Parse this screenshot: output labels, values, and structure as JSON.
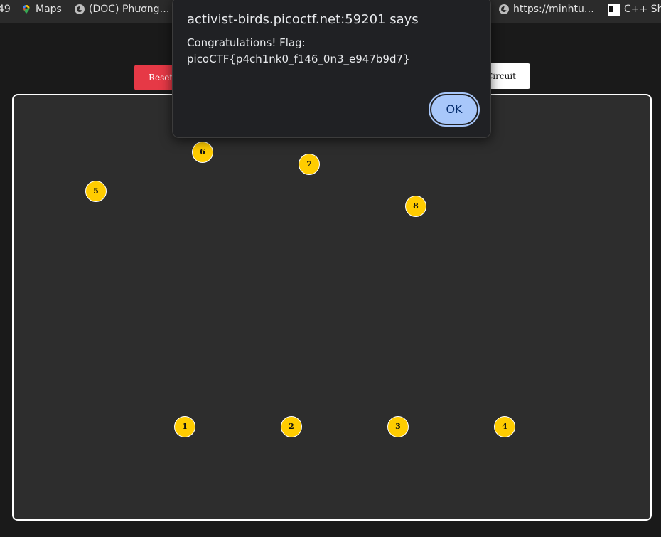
{
  "bookmarks": {
    "items": [
      {
        "label": "49",
        "icon": "none"
      },
      {
        "label": "Maps",
        "icon": "maps-pin-icon"
      },
      {
        "label": "(DOC) Phương…",
        "icon": "globe-icon"
      },
      {
        "label": "https://minhtu…",
        "icon": "globe-icon"
      },
      {
        "label": "C++ She",
        "icon": "sheet-icon"
      }
    ]
  },
  "toolbar": {
    "reset_label": "Reset",
    "circuit_label": "Circuit"
  },
  "board": {
    "nodes": [
      {
        "label": "1"
      },
      {
        "label": "2"
      },
      {
        "label": "3"
      },
      {
        "label": "4"
      },
      {
        "label": "5"
      },
      {
        "label": "6"
      },
      {
        "label": "7"
      },
      {
        "label": "8"
      }
    ],
    "node_color": "#ffcc00"
  },
  "dialog": {
    "title": "activist-birds.picoctf.net:59201 says",
    "message_line1": "Congratulations! Flag:",
    "message_line2": "picoCTF{p4ch1nk0_f146_0n3_e947b9d7}",
    "ok_label": "OK"
  },
  "colors": {
    "reset_button": "#e63946",
    "ok_button": "#a8c7fa",
    "background": "#1a1a1a",
    "board": "#2d2d2d"
  }
}
